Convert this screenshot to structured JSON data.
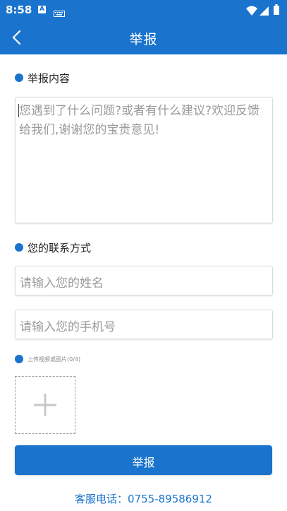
{
  "status_bar": {
    "time": "8:58",
    "notification_badge": "A",
    "icons": [
      "keyboard-icon",
      "wifi-icon",
      "signal-icon",
      "battery-icon"
    ]
  },
  "header": {
    "title": "举报",
    "back_icon": "chevron-left-icon"
  },
  "report_section": {
    "label": "举报内容",
    "placeholder": "您遇到了什么问题?或者有什么建议?欢迎反馈给我们,谢谢您的宝贵意见!"
  },
  "contact_section": {
    "label": "您的联系方式",
    "name_placeholder": "请输入您的姓名",
    "phone_placeholder": "请输入您的手机号"
  },
  "upload": {
    "label": "上传视频或图片(0/4)",
    "add_icon": "plus-icon"
  },
  "submit": {
    "label": "举报"
  },
  "footer": {
    "hotline": "客服电话：0755-89586912"
  },
  "colors": {
    "primary": "#1a73cd",
    "placeholder_text": "#9a9a9a",
    "border": "#dcdcdc",
    "background": "#ffffff"
  }
}
